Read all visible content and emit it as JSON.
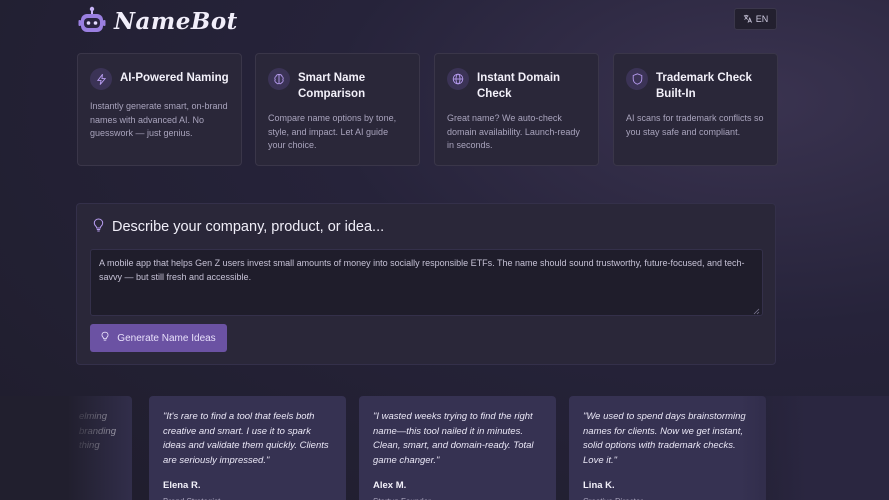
{
  "header": {
    "brand": "NameBot",
    "language_label": "EN"
  },
  "features": [
    {
      "icon": "lightning-icon",
      "title": "AI-Powered Naming",
      "desc": "Instantly generate smart, on-brand names with advanced AI. No guesswork — just genius."
    },
    {
      "icon": "brain-icon",
      "title": "Smart Name Comparison",
      "desc": "Compare name options by tone, style, and impact. Let AI guide your choice."
    },
    {
      "icon": "globe-icon",
      "title": "Instant Domain Check",
      "desc": "Great name? We auto-check domain availability. Launch-ready in seconds."
    },
    {
      "icon": "shield-icon",
      "title": "Trademark Check Built-In",
      "desc": "AI scans for trademark conflicts so you stay safe and compliant."
    }
  ],
  "describe": {
    "title": "Describe your company, product, or idea...",
    "input_value": "A mobile app that helps Gen Z users invest small amounts of money into socially responsible ETFs. The name should sound trustworthy, future-focused, and tech-savvy — but still fresh and accessible.",
    "generate_label": "Generate Name Ideas"
  },
  "testimonials": [
    {
      "quote": "...elming ...branding ...thing",
      "name": "",
      "role": ""
    },
    {
      "quote": "\"It's rare to find a tool that feels both creative and smart. I use it to spark ideas and validate them quickly. Clients are seriously impressed.\"",
      "name": "Elena R.",
      "role": "Brand Strategist"
    },
    {
      "quote": "\"I wasted weeks trying to find the right name—this tool nailed it in minutes. Clean, smart, and domain-ready. Total game changer.\"",
      "name": "Alex M.",
      "role": "Startup Founder"
    },
    {
      "quote": "\"We used to spend days brainstorming names for clients. Now we get instant, solid options with trademark checks. Love it.\"",
      "name": "Lina K.",
      "role": "Creative Director"
    }
  ],
  "partial_testimonial_lines": [
    "elming",
    "branding",
    "thing"
  ],
  "colors": {
    "accent": "#6b52a3",
    "icon_stroke": "#b79cf0"
  }
}
